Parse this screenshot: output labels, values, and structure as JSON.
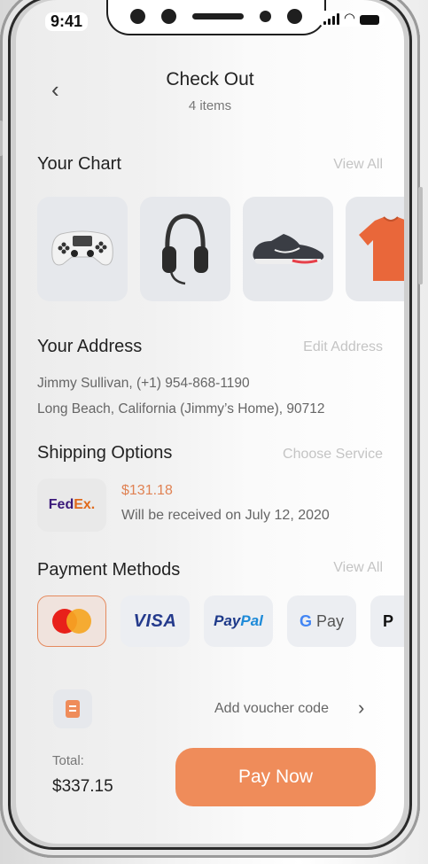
{
  "status_bar": {
    "time": "9:41"
  },
  "header": {
    "title": "Check Out",
    "subtitle": "4 items",
    "back_icon": "‹"
  },
  "cart": {
    "heading": "Your Chart",
    "link": "View All",
    "items": [
      {
        "name": "game-controller"
      },
      {
        "name": "headphones"
      },
      {
        "name": "sneaker"
      },
      {
        "name": "orange-t-shirt"
      }
    ]
  },
  "address": {
    "heading": "Your Address",
    "link": "Edit Address",
    "line1": "Jimmy Sullivan, (+1) 954-868-1190",
    "line2": "Long Beach, California (Jimmy’s Home), 90712"
  },
  "shipping": {
    "heading": "Shipping Options",
    "link": "Choose Service",
    "carrier_fe": "Fed",
    "carrier_ex": "Ex.",
    "price": "$131.18",
    "eta": "Will be received on July 12, 2020"
  },
  "payment": {
    "heading": "Payment Methods",
    "link": "View All",
    "visa": "VISA",
    "paypal_a": "Pay",
    "paypal_b": "Pal",
    "gpay_g": "G",
    "gpay_rest": " Pay",
    "apple_pay": "P"
  },
  "voucher": {
    "text": "Add voucher code",
    "arrow": "›"
  },
  "footer": {
    "total_label": "Total:",
    "total_value": "$337.15",
    "pay_button": "Pay Now"
  },
  "colors": {
    "accent": "#ef8c5a",
    "muted_link": "#c4c4c4"
  }
}
